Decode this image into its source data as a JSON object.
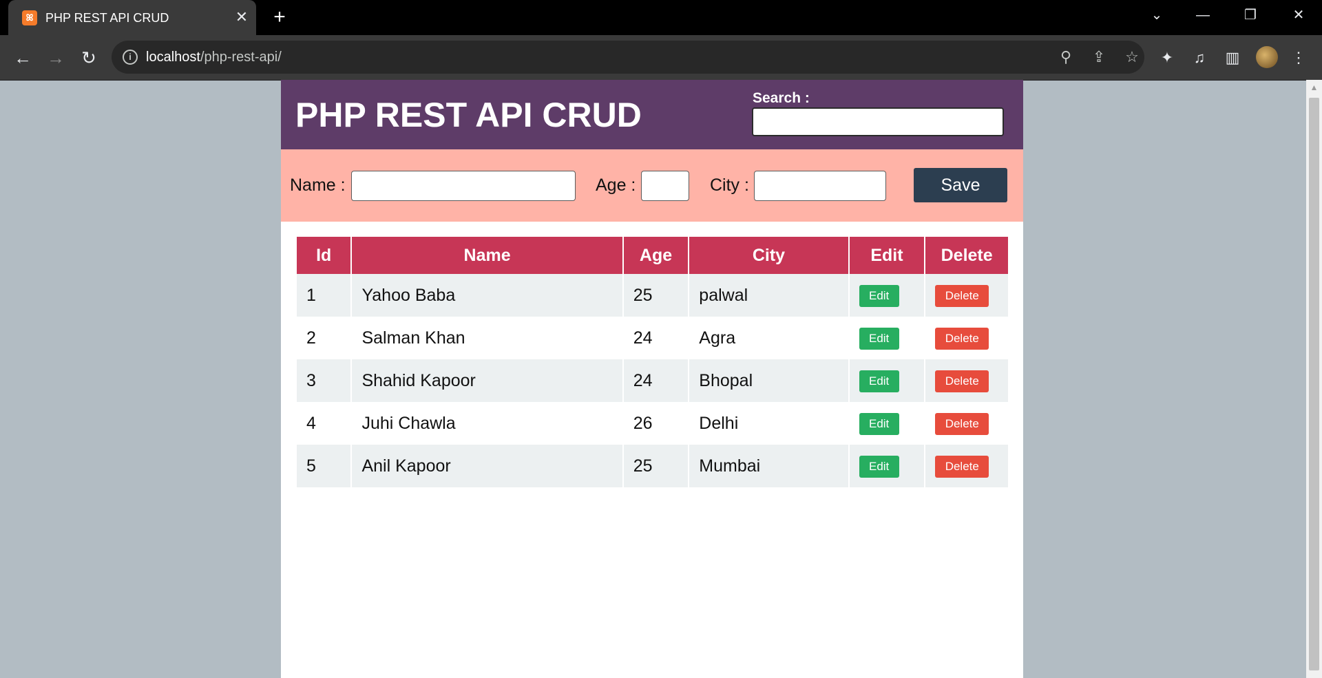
{
  "browser": {
    "tab_title": "PHP REST API CRUD",
    "favicon_icon": "xampp-icon",
    "new_tab_label": "+",
    "url_host": "localhost",
    "url_path": "/php-rest-api/"
  },
  "app": {
    "title": "PHP REST API CRUD",
    "search_label": "Search :",
    "search_value": ""
  },
  "form": {
    "name_label": "Name :",
    "age_label": "Age :",
    "city_label": "City :",
    "name_value": "",
    "age_value": "",
    "city_value": "",
    "save_label": "Save"
  },
  "table": {
    "headers": [
      "Id",
      "Name",
      "Age",
      "City",
      "Edit",
      "Delete"
    ],
    "edit_label": "Edit",
    "delete_label": "Delete",
    "rows": [
      {
        "id": "1",
        "name": "Yahoo Baba",
        "age": "25",
        "city": "palwal"
      },
      {
        "id": "2",
        "name": "Salman Khan",
        "age": "24",
        "city": "Agra"
      },
      {
        "id": "3",
        "name": "Shahid Kapoor",
        "age": "24",
        "city": "Bhopal"
      },
      {
        "id": "4",
        "name": "Juhi Chawla",
        "age": "26",
        "city": "Delhi"
      },
      {
        "id": "5",
        "name": "Anil Kapoor",
        "age": "25",
        "city": "Mumbai"
      }
    ]
  },
  "colors": {
    "header_bg": "#5e3c68",
    "form_bg": "#ffb3a7",
    "table_head_bg": "#c73656",
    "save_bg": "#2c3e50",
    "edit_bg": "#27ae60",
    "delete_bg": "#e74c3c",
    "page_bg": "#b2bcc3"
  }
}
